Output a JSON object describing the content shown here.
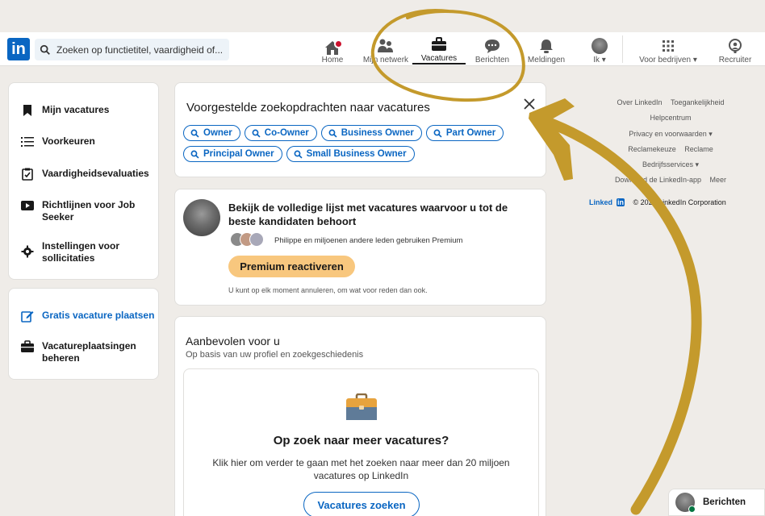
{
  "header": {
    "logo": "in",
    "search_placeholder": "Zoeken op functietitel, vaardigheid of...",
    "nav": [
      {
        "label": "Home",
        "icon": "home-icon"
      },
      {
        "label": "Mijn netwerk",
        "icon": "network-icon"
      },
      {
        "label": "Vacatures",
        "icon": "briefcase-icon"
      },
      {
        "label": "Berichten",
        "icon": "messaging-icon"
      },
      {
        "label": "Meldingen",
        "icon": "bell-icon"
      },
      {
        "label": "Ik ▾",
        "icon": "avatar"
      },
      {
        "label": "Voor bedrijven ▾",
        "icon": "grid-icon"
      },
      {
        "label": "Recruiter",
        "icon": "recruiter-icon"
      }
    ]
  },
  "sidebar": {
    "items": [
      {
        "label": "Mijn vacatures",
        "icon": "bookmark-icon"
      },
      {
        "label": "Voorkeuren",
        "icon": "list-icon"
      },
      {
        "label": "Vaardigheidsevaluaties",
        "icon": "clipboard-icon"
      },
      {
        "label": "Richtlijnen voor Job Seeker",
        "icon": "play-icon"
      },
      {
        "label": "Instellingen voor sollicitaties",
        "icon": "gear-icon"
      }
    ],
    "post_job": {
      "label": "Gratis vacature plaatsen",
      "icon": "edit-icon"
    },
    "manage": {
      "label": "Vacatureplaatsingen beheren",
      "icon": "briefcase-icon"
    }
  },
  "suggestions": {
    "title": "Voorgestelde zoekopdrachten naar vacatures",
    "pills": [
      "Owner",
      "Co-Owner",
      "Business Owner",
      "Part Owner",
      "Principal Owner",
      "Small Business Owner"
    ]
  },
  "premium": {
    "title": "Bekijk de volledige lijst met vacatures waarvoor u tot de beste kandidaten behoort",
    "social": "Philippe en miljoenen andere leden gebruiken Premium",
    "button": "Premium reactiveren",
    "fine": "U kunt op elk moment annuleren, om wat voor reden dan ook."
  },
  "recommended": {
    "title": "Aanbevolen voor u",
    "subtitle": "Op basis van uw profiel en zoekgeschiedenis",
    "heading": "Op zoek naar meer vacatures?",
    "description": "Klik hier om verder te gaan met het zoeken naar meer dan 20 miljoen vacatures op LinkedIn",
    "button": "Vacatures zoeken"
  },
  "footer": {
    "links": [
      "Over LinkedIn",
      "Toegankelijkheid",
      "Helpcentrum",
      "Privacy en voorwaarden ▾",
      "Reclamekeuze",
      "Reclame",
      "Bedrijfsservices ▾",
      "Download de LinkedIn-app",
      "Meer"
    ],
    "brand_prefix": "Linked",
    "brand_suffix": "in",
    "copyright": " © 2024 LinkedIn Corporation"
  },
  "messaging": {
    "label": "Berichten"
  },
  "colors": {
    "accent": "#0a66c2",
    "premium": "#f8c77e",
    "annotation": "#c49a2c"
  }
}
